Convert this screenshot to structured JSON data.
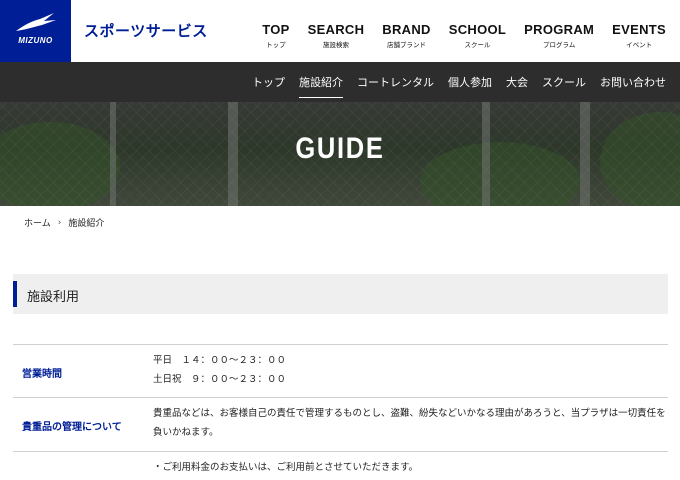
{
  "brand": {
    "logo_text": "MIZUNO",
    "site_title": "スポーツサービス",
    "accent_color": "#001e96"
  },
  "main_nav": [
    {
      "en": "TOP",
      "ja": "トップ"
    },
    {
      "en": "SEARCH",
      "ja": "施設検索"
    },
    {
      "en": "BRAND",
      "ja": "店舗ブランド"
    },
    {
      "en": "SCHOOL",
      "ja": "スクール"
    },
    {
      "en": "PROGRAM",
      "ja": "プログラム"
    },
    {
      "en": "EVENTS",
      "ja": "イベント"
    }
  ],
  "sub_nav": [
    {
      "label": "トップ",
      "active": false
    },
    {
      "label": "施設紹介",
      "active": true
    },
    {
      "label": "コートレンタル",
      "active": false
    },
    {
      "label": "個人参加",
      "active": false
    },
    {
      "label": "大会",
      "active": false
    },
    {
      "label": "スクール",
      "active": false
    },
    {
      "label": "お問い合わせ",
      "active": false
    }
  ],
  "hero": {
    "title": "GUIDE"
  },
  "breadcrumb": {
    "home": "ホーム",
    "separator": "›",
    "current": "施設紹介"
  },
  "section": {
    "title": "施設利用"
  },
  "table": {
    "hours": {
      "label": "営業時間",
      "line1": "平日　１４：００〜２３：００",
      "line2": "土日祝　９：００〜２３：００"
    },
    "valuables": {
      "label": "貴重品の管理について",
      "line1": "貴重品などは、お客様自己の責任で管理するものとし、盗難、紛失などいかなる理由があろうと、当プラザは一切責任を",
      "line2": "負いかねます。"
    },
    "payment": {
      "line1": "・ご利用料金のお支払いは、ご利用前とさせていただきます。"
    }
  }
}
